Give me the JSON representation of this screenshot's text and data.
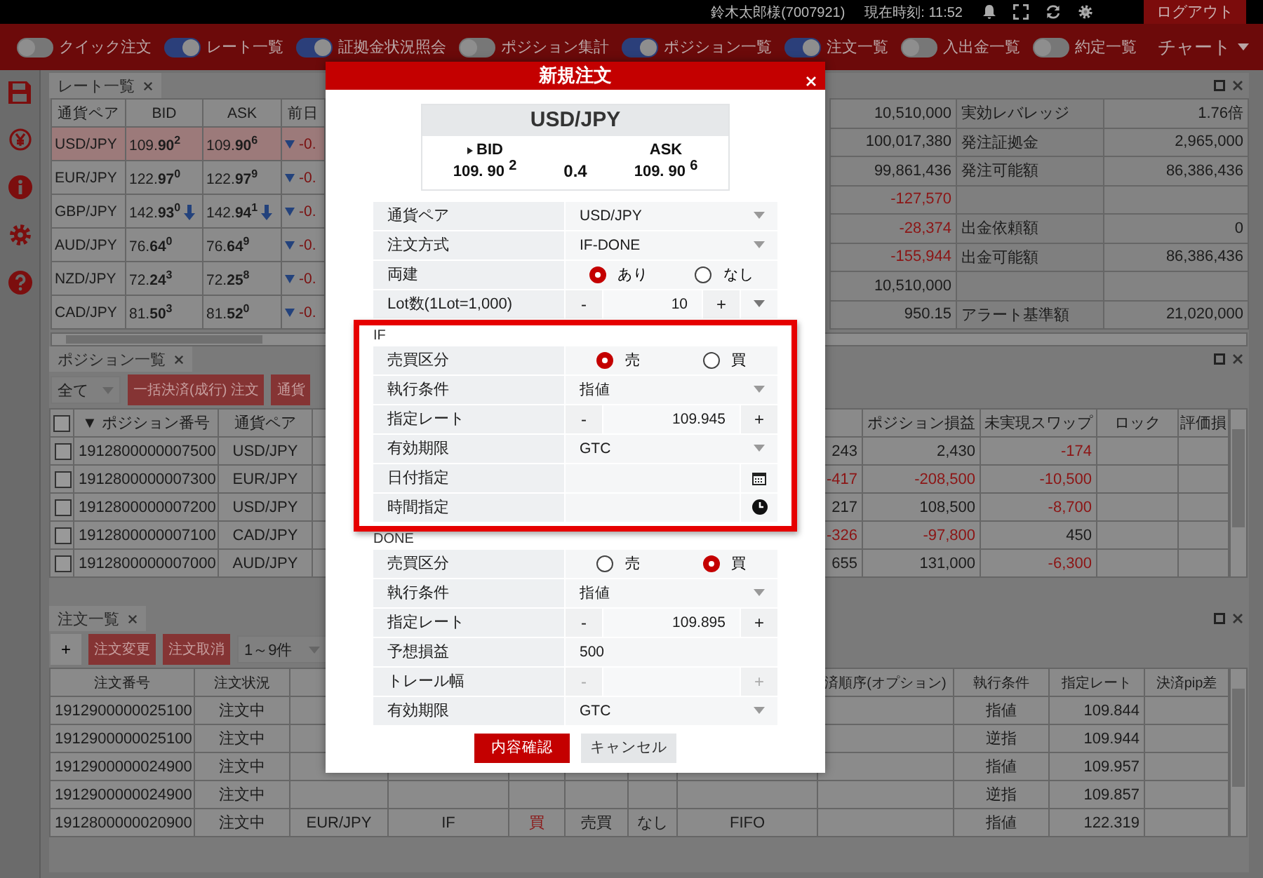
{
  "topbar": {
    "user": "鈴木太郎様(7007921)",
    "clock": "現在時刻: 11:52",
    "logout": "ログアウト"
  },
  "toolbar": {
    "toggles": [
      {
        "label": "クイック注文",
        "on": false
      },
      {
        "label": "レート一覧",
        "on": true
      },
      {
        "label": "証拠金状況照会",
        "on": true
      },
      {
        "label": "ポジション集計",
        "on": false
      },
      {
        "label": "ポジション一覧",
        "on": true
      },
      {
        "label": "注文一覧",
        "on": true
      },
      {
        "label": "入出金一覧",
        "on": false
      },
      {
        "label": "約定一覧",
        "on": false
      }
    ],
    "chart": "チャート"
  },
  "rate_panel": {
    "tab": "レート一覧",
    "columns": [
      "通貨ペア",
      "BID",
      "ASK",
      "前日"
    ],
    "rows": [
      {
        "pair": "USD/JPY",
        "bid": "109.**90**$^{2}$",
        "ask": "109.**90**$^{6}$",
        "bid_down": false,
        "ask_down": false,
        "change": "-0.",
        "selected": true
      },
      {
        "pair": "EUR/JPY",
        "bid": "122.**97**$^{0}$",
        "ask": "122.**97**$^{9}$",
        "bid_down": false,
        "ask_down": false,
        "change": "-0.",
        "selected": false
      },
      {
        "pair": "GBP/JPY",
        "bid": "142.**93**$^{0}$",
        "ask": "142.**94**$^{1}$",
        "bid_down": true,
        "ask_down": true,
        "change": "-0.",
        "selected": false
      },
      {
        "pair": "AUD/JPY",
        "bid": "76.**64**$^{0}$",
        "ask": "76.**64**$^{9}$",
        "bid_down": false,
        "ask_down": false,
        "change": "-0.",
        "selected": false
      },
      {
        "pair": "NZD/JPY",
        "bid": "72.**24**$^{3}$",
        "ask": "72.**25**$^{8}$",
        "bid_down": false,
        "ask_down": false,
        "change": "-0.",
        "selected": false
      },
      {
        "pair": "CAD/JPY",
        "bid": "81.**50**$^{3}$",
        "ask": "81.**52**$^{0}$",
        "bid_down": false,
        "ask_down": false,
        "change": "-0.",
        "selected": false
      }
    ]
  },
  "summary": {
    "rows": [
      {
        "value": {
          "text": "10,510,000",
          "negative": false
        },
        "label": "実効レバレッジ",
        "amount": "1.76倍"
      },
      {
        "value": {
          "text": "100,017,380",
          "negative": false
        },
        "label": "発注証拠金",
        "amount": "2,965,000"
      },
      {
        "value": {
          "text": "99,861,436",
          "negative": false
        },
        "label": "発注可能額",
        "amount": "86,386,436"
      },
      {
        "value": {
          "text": "-127,570",
          "negative": true
        }
      },
      {
        "value": {
          "text": "-28,374",
          "negative": true
        },
        "label": "出金依頼額",
        "amount": "0"
      },
      {
        "value": {
          "text": "-155,944",
          "negative": true
        },
        "label": "出金可能額",
        "amount": "86,386,436"
      },
      {
        "value": {
          "text": "10,510,000",
          "negative": false
        }
      },
      {
        "value": {
          "text": "950.15",
          "negative": false
        },
        "label": "アラート基準額",
        "amount": "21,020,000"
      }
    ]
  },
  "positions_panel": {
    "tab": "ポジション一覧",
    "filter": "全て",
    "buttons": [
      "一括決済(成行) 注文",
      "通貨"
    ],
    "select_all": false,
    "columns": [
      "▼ ポジション番号",
      "通貨ペア",
      null,
      null,
      null,
      null,
      "ポジション損益",
      "未実現スワップ",
      "ロック",
      "評価損"
    ],
    "rows": [
      {
        "checked": false,
        "cells": [
          "1912800000007500",
          "USD/JPY",
          null,
          null,
          null,
          {
            "text": "243",
            "negative": false
          },
          {
            "text": "2,430",
            "negative": false
          },
          {
            "text": "-174",
            "negative": true
          },
          null,
          null
        ]
      },
      {
        "checked": false,
        "cells": [
          "1912800000007300",
          "EUR/JPY",
          null,
          null,
          null,
          {
            "text": "-417",
            "negative": true
          },
          {
            "text": "-208,500",
            "negative": true
          },
          {
            "text": "-10,500",
            "negative": true
          },
          null,
          null
        ]
      },
      {
        "checked": false,
        "cells": [
          "1912800000007200",
          "USD/JPY",
          null,
          null,
          null,
          {
            "text": "217",
            "negative": false
          },
          {
            "text": "108,500",
            "negative": false
          },
          {
            "text": "-8,700",
            "negative": true
          },
          null,
          null
        ]
      },
      {
        "checked": false,
        "cells": [
          "1912800000007100",
          "CAD/JPY",
          null,
          null,
          null,
          {
            "text": "-326",
            "negative": true
          },
          {
            "text": "-97,800",
            "negative": true
          },
          {
            "text": "450",
            "negative": false
          },
          null,
          null
        ]
      },
      {
        "checked": false,
        "cells": [
          "1912800000007000",
          "AUD/JPY",
          null,
          null,
          null,
          {
            "text": "655",
            "negative": false
          },
          {
            "text": "131,000",
            "negative": false
          },
          {
            "text": "-6,300",
            "negative": true
          },
          null,
          null
        ]
      }
    ]
  },
  "orders_panel": {
    "tab": "注文一覧",
    "add": "+",
    "buttons": [
      "注文変更",
      "注文取消"
    ],
    "range": "1～9件",
    "columns": [
      "注文番号",
      "注文状況",
      null,
      null,
      null,
      null,
      null,
      null,
      "済順序(オプション)",
      "執行条件",
      "指定レート",
      "決済pip差"
    ],
    "rows": [
      {
        "cells": [
          "1912900000025100",
          "注文中",
          null,
          null,
          null,
          null,
          null,
          null,
          null,
          "指値",
          "109.844",
          null
        ]
      },
      {
        "cells": [
          "1912900000025100",
          "注文中",
          null,
          null,
          null,
          null,
          null,
          null,
          null,
          "逆指",
          "109.944",
          null
        ]
      },
      {
        "cells": [
          "1912900000024900",
          "注文中",
          null,
          null,
          null,
          null,
          null,
          null,
          null,
          "指値",
          "109.957",
          null
        ]
      },
      {
        "cells": [
          "1912900000024900",
          "注文中",
          null,
          null,
          null,
          null,
          null,
          null,
          null,
          "逆指",
          "109.857",
          null
        ]
      },
      {
        "cells": [
          "1912800000020900",
          "注文中",
          "EUR/JPY",
          "IF",
          {
            "text": "買",
            "negative": true
          },
          "売買",
          "なし",
          "FIFO",
          null,
          "指値",
          "122.319",
          null
        ]
      }
    ]
  },
  "order_dialog": {
    "title": "新規注文",
    "quote": {
      "pair": "USD/JPY",
      "bid_label": "BID",
      "ask_label": "ASK",
      "bid": "109. **90** $^{2}$",
      "spread": "0.4",
      "ask": "109. **90** $^{6}$"
    },
    "fields": [
      {
        "kind": "select",
        "label": "通貨ペア",
        "value": "USD/JPY"
      },
      {
        "kind": "select",
        "label": "注文方式",
        "value": "IF-DONE"
      },
      {
        "kind": "radio",
        "label": "両建",
        "options": [
          {
            "label": "あり",
            "selected": true
          },
          {
            "label": "なし",
            "selected": false
          }
        ]
      },
      {
        "kind": "stepper",
        "label": "Lot数(1Lot=1,000)",
        "minus": "-",
        "value": "10",
        "plus": "+",
        "dropdown": true,
        "disabled": false
      }
    ],
    "sections": [
      {
        "label": "IF",
        "highlighted": true,
        "fields": [
          {
            "kind": "radio",
            "label": "売買区分",
            "options": [
              {
                "label": "売",
                "selected": true
              },
              {
                "label": "買",
                "selected": false
              }
            ]
          },
          {
            "kind": "select",
            "label": "執行条件",
            "value": "指値"
          },
          {
            "kind": "stepper",
            "label": "指定レート",
            "minus": "-",
            "value": "109.945",
            "plus": "+",
            "dropdown": false,
            "disabled": false
          },
          {
            "kind": "select",
            "label": "有効期限",
            "value": "GTC"
          },
          {
            "kind": "date",
            "label": "日付指定"
          },
          {
            "kind": "time",
            "label": "時間指定"
          }
        ]
      },
      {
        "label": "DONE",
        "highlighted": false,
        "fields": [
          {
            "kind": "radio",
            "label": "売買区分",
            "options": [
              {
                "label": "売",
                "selected": false
              },
              {
                "label": "買",
                "selected": true
              }
            ]
          },
          {
            "kind": "select",
            "label": "執行条件",
            "value": "指値"
          },
          {
            "kind": "stepper",
            "label": "指定レート",
            "minus": "-",
            "value": "109.895",
            "plus": "+",
            "dropdown": false,
            "disabled": false
          },
          {
            "kind": "text",
            "label": "予想損益",
            "value": "500"
          },
          {
            "kind": "stepper",
            "label": "トレール幅",
            "minus": "-",
            "plus": "+",
            "dropdown": false,
            "disabled": true
          },
          {
            "kind": "select",
            "label": "有効期限",
            "value": "GTC"
          }
        ]
      }
    ],
    "actions": [
      {
        "label": "内容確認",
        "primary": true
      },
      {
        "label": "キャンセル",
        "primary": false
      }
    ]
  }
}
